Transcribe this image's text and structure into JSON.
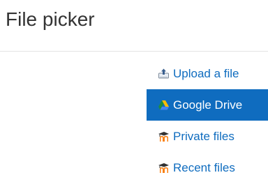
{
  "dialog": {
    "title": "File picker"
  },
  "repositories": [
    {
      "label": "Upload a file",
      "icon": "upload-icon",
      "active": false
    },
    {
      "label": "Google Drive",
      "icon": "google-drive-icon",
      "active": true
    },
    {
      "label": "Private files",
      "icon": "moodle-icon",
      "active": false
    },
    {
      "label": "Recent files",
      "icon": "moodle-icon",
      "active": false
    }
  ],
  "colors": {
    "accent": "#0f6cbf",
    "title_text": "#333333",
    "divider": "#e3e3e3",
    "moodle_orange": "#f98012",
    "moodle_dark": "#333333"
  }
}
